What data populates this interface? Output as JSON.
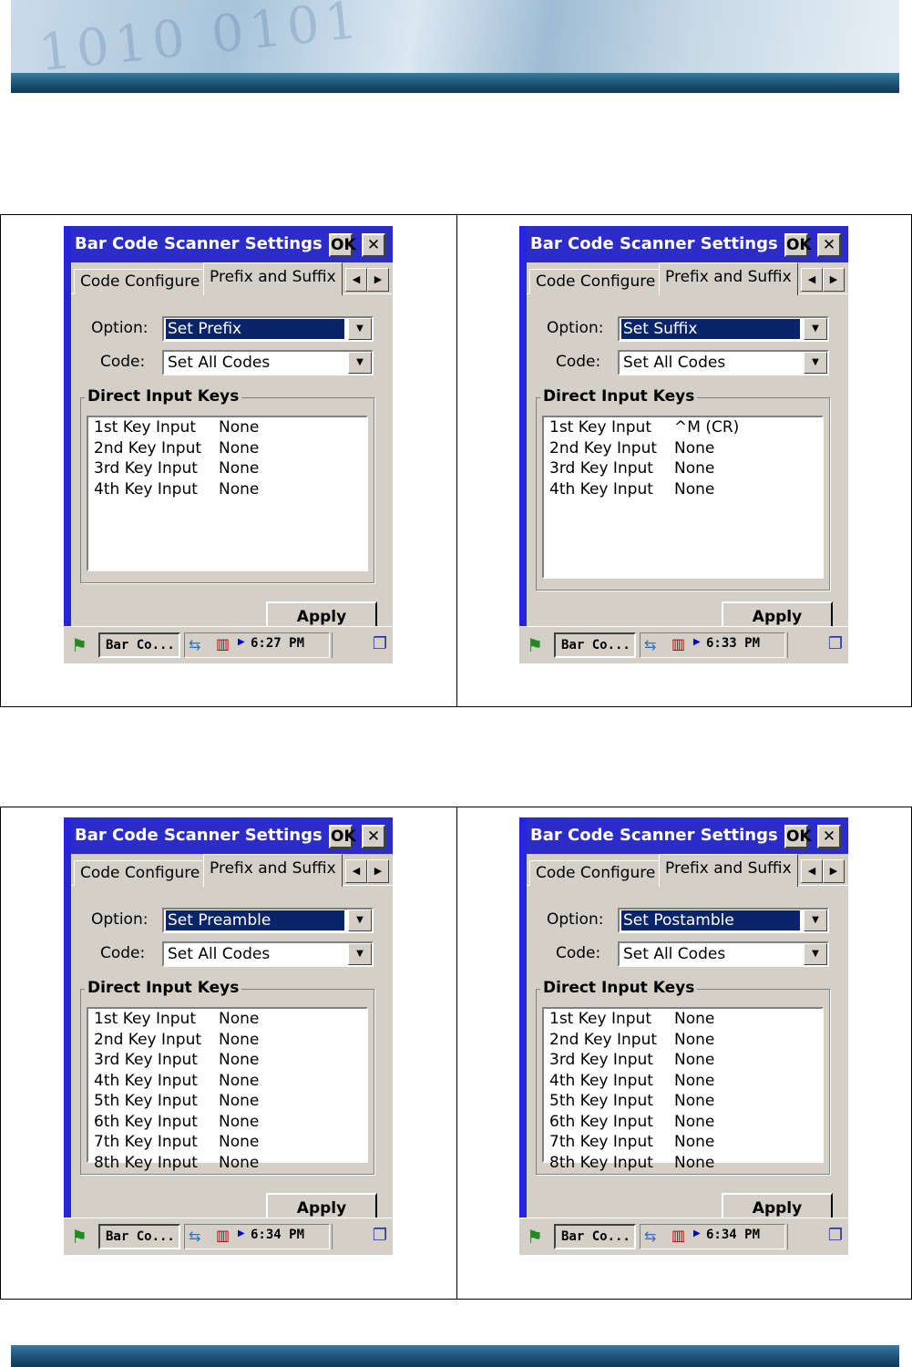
{
  "window": {
    "title": "Bar Code Scanner Settings",
    "ok_label": "OK",
    "close_label": "✕",
    "tabs": [
      "Code Configure",
      "Prefix and Suffix"
    ],
    "option_label": "Option:",
    "code_label": "Code:",
    "groupbox_title": "Direct Input Keys",
    "apply_label": "Apply"
  },
  "taskbar": {
    "app_label": "Bar Co...",
    "start_icon": "windows-flag-icon"
  },
  "screens": [
    {
      "option": "Set Prefix",
      "code": "Set All Codes",
      "time": "6:27 PM",
      "keys": [
        {
          "key": "1st  Key Input",
          "value": "None"
        },
        {
          "key": "2nd Key Input",
          "value": "None"
        },
        {
          "key": "3rd Key Input",
          "value": "None"
        },
        {
          "key": "4th Key Input",
          "value": "None"
        }
      ]
    },
    {
      "option": "Set Suffix",
      "code": "Set All Codes",
      "time": "6:33 PM",
      "keys": [
        {
          "key": "1st  Key Input",
          "value": "^M (CR)"
        },
        {
          "key": "2nd Key Input",
          "value": "None"
        },
        {
          "key": "3rd Key Input",
          "value": "None"
        },
        {
          "key": "4th Key Input",
          "value": "None"
        }
      ]
    },
    {
      "option": "Set Preamble",
      "code": "Set All Codes",
      "time": "6:34 PM",
      "keys": [
        {
          "key": "1st  Key Input",
          "value": "None"
        },
        {
          "key": "2nd Key Input",
          "value": "None"
        },
        {
          "key": "3rd Key Input",
          "value": "None"
        },
        {
          "key": "4th Key Input",
          "value": "None"
        },
        {
          "key": "5th Key Input",
          "value": "None"
        },
        {
          "key": "6th Key Input",
          "value": "None"
        },
        {
          "key": "7th Key Input",
          "value": "None"
        },
        {
          "key": "8th Key Input",
          "value": "None"
        }
      ]
    },
    {
      "option": "Set Postamble",
      "code": "Set All Codes",
      "time": "6:34 PM",
      "keys": [
        {
          "key": "1st  Key Input",
          "value": "None"
        },
        {
          "key": "2nd Key Input",
          "value": "None"
        },
        {
          "key": "3rd Key Input",
          "value": "None"
        },
        {
          "key": "4th Key Input",
          "value": "None"
        },
        {
          "key": "5th Key Input",
          "value": "None"
        },
        {
          "key": "6th Key Input",
          "value": "None"
        },
        {
          "key": "7th Key Input",
          "value": "None"
        },
        {
          "key": "8th Key Input",
          "value": "None"
        }
      ]
    }
  ],
  "colors": {
    "selection": "#0a246a",
    "titlebar": "#2c2cc8",
    "dialog_face": "#d4d0c8",
    "banner_band": "#1a4e72"
  }
}
